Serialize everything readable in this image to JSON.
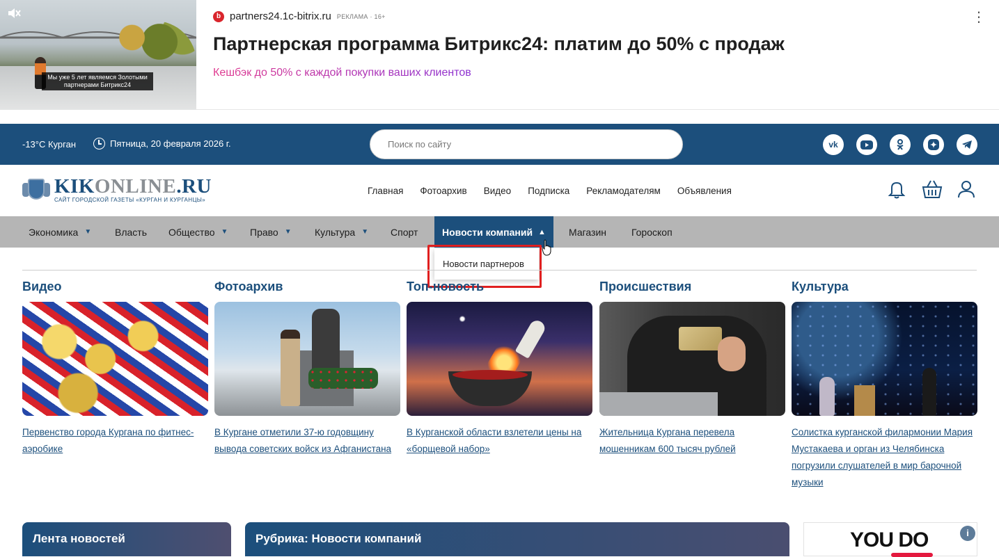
{
  "ad": {
    "image_caption": "Мы уже 5 лет являемся Золотыми партнерами Битрикс24",
    "domain": "partners24.1c-bitrix.ru",
    "tag": "РЕКЛАМА · 16+",
    "title": "Партнерская программа Битрикс24: платим до 50% с продаж",
    "subtitle": "Кешбэк до 50% с каждой покупки ваших клиентов",
    "more": "⋮"
  },
  "topbar": {
    "weather": "-13°C  Курган",
    "date": "Пятница, 20 февраля 2026 г.",
    "search_placeholder": "Поиск по сайту",
    "socials": [
      {
        "name": "vk-icon",
        "glyph": "vk"
      },
      {
        "name": "youtube-icon",
        "glyph": "▶"
      },
      {
        "name": "odnoklassniki-icon",
        "glyph": "ok"
      },
      {
        "name": "dzen-icon",
        "glyph": "✦"
      },
      {
        "name": "telegram-icon",
        "glyph": "➤"
      }
    ]
  },
  "header": {
    "logo_kik": "KIK",
    "logo_online": "ONLINE",
    "logo_ru": ".RU",
    "logo_sub": "САЙТ ГОРОДСКОЙ ГАЗЕТЫ «КУРГАН И КУРГАНЦЫ»",
    "nav": [
      "Главная",
      "Фотоархив",
      "Видео",
      "Подписка",
      "Рекламодателям",
      "Объявления"
    ]
  },
  "categories": [
    {
      "label": "Экономика",
      "dropdown": true
    },
    {
      "label": "Власть",
      "dropdown": false
    },
    {
      "label": "Общество",
      "dropdown": true
    },
    {
      "label": "Право",
      "dropdown": true
    },
    {
      "label": "Культура",
      "dropdown": true
    },
    {
      "label": "Спорт",
      "dropdown": false
    },
    {
      "label": "Новости компаний",
      "dropdown": true,
      "active": true
    },
    {
      "label": "Магазин",
      "dropdown": false
    },
    {
      "label": "Гороскоп",
      "dropdown": false
    }
  ],
  "dropdown_item": "Новости партнеров",
  "columns": [
    {
      "heading": "Видео",
      "title": "Первенство города Кургана по фитнес-аэробике"
    },
    {
      "heading": "Фотоархив",
      "title": "В Кургане отметили 37-ю годовщину вывода советских войск из Афганистана"
    },
    {
      "heading": "Топ-новость",
      "title": "В Курганской области взлетели цены на «борщевой набор»"
    },
    {
      "heading": "Происшествия",
      "title": "Жительница Кургана перевела мошенникам 600 тысяч рублей"
    },
    {
      "heading": "Культура",
      "title": "Солистка курганской филармонии Мария Мустакаева и орган из Челябинска погрузили слушателей в мир барочной музыки"
    }
  ],
  "blocks": {
    "news_feed": "Лента новостей",
    "rubric": "Рубрика: Новости компаний",
    "youdo": "YOU DO",
    "info": "i"
  },
  "colors": {
    "primary": "#1c4f7c",
    "catbar": "#b5b5b5",
    "highlight": "#e01f1f"
  }
}
